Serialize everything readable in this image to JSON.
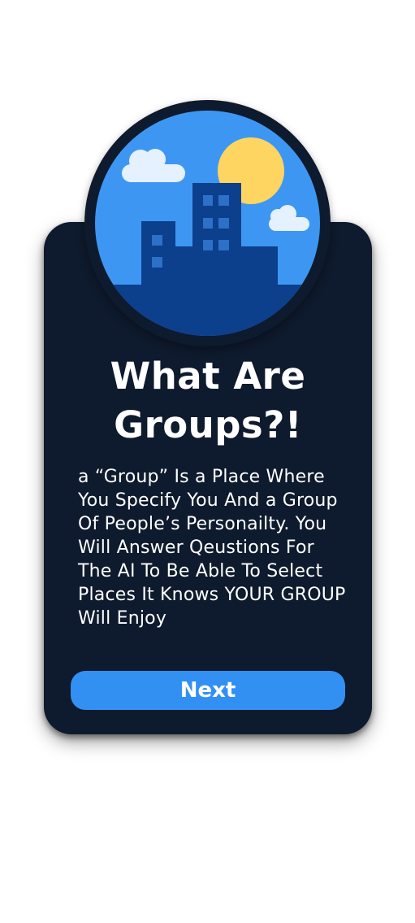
{
  "modal": {
    "title": "What Are Groups?!",
    "description": "a “Group” Is a Place Where You Specify You And a Group Of People’s Personailty. You Will Answer Qeustions For The AI To Be Able To Select Places It Knows YOUR GROUP Will Enjoy",
    "next_label": "Next",
    "illustration_icon": "city-skyline-icon"
  },
  "colors": {
    "card_background": "#0e1a2d",
    "button": "#3390f3",
    "sky": "#3d97f2",
    "sun": "#ffd561",
    "buildings": "#0c3f8c",
    "windows": "#2c70c8",
    "clouds": "#e6f1ff"
  }
}
